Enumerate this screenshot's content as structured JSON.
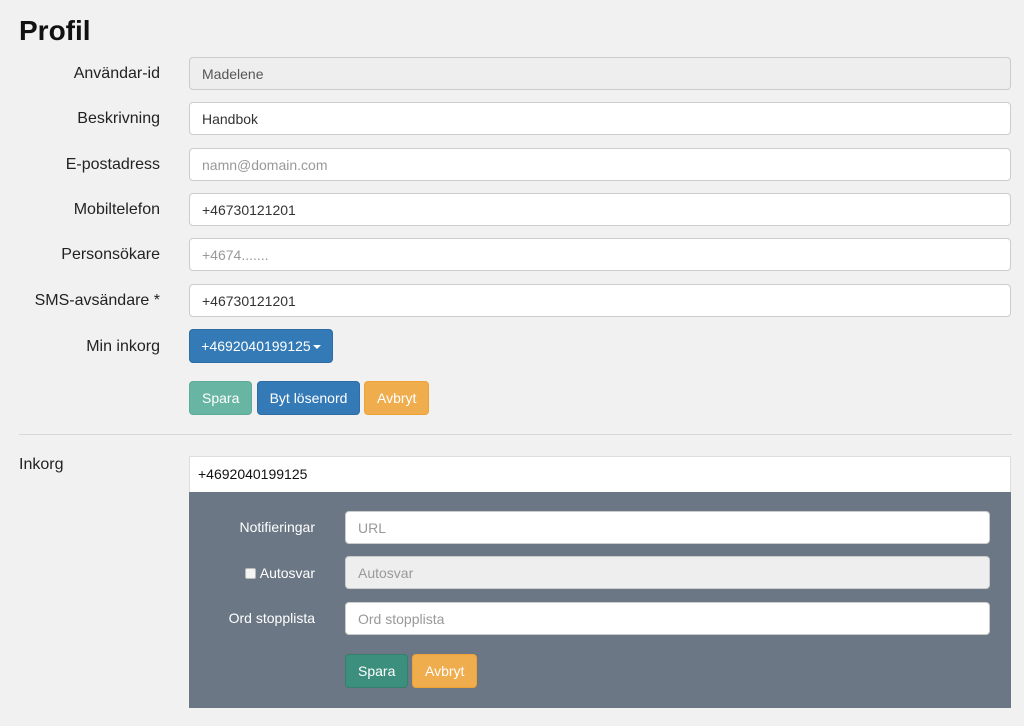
{
  "page": {
    "title": "Profil"
  },
  "profile_form": {
    "user_id": {
      "label": "Användar-id",
      "value": "Madelene"
    },
    "description": {
      "label": "Beskrivning",
      "value": "Handbok"
    },
    "email": {
      "label": "E-postadress",
      "value": "",
      "placeholder": "namn@domain.com"
    },
    "mobile": {
      "label": "Mobiltelefon",
      "value": "+46730121201"
    },
    "pager": {
      "label": "Personsökare",
      "value": "",
      "placeholder": "+4674......."
    },
    "sms_sender": {
      "label": "SMS-avsändare *",
      "value": "+46730121201"
    },
    "my_inbox": {
      "label": "Min inkorg",
      "selected": "+4692040199125"
    },
    "buttons": {
      "save": "Spara",
      "change_password": "Byt lösenord",
      "cancel": "Avbryt"
    }
  },
  "inbox_section": {
    "label": "Inkorg",
    "inbox_number": "+4692040199125",
    "notifications": {
      "label": "Notifieringar",
      "value": "",
      "placeholder": "URL"
    },
    "autoreply": {
      "label": "Autosvar",
      "checked": false,
      "value": "",
      "placeholder": "Autosvar"
    },
    "stopword_list": {
      "label": "Ord stopplista",
      "value": "",
      "placeholder": "Ord stopplista"
    },
    "buttons": {
      "save": "Spara",
      "cancel": "Avbryt"
    }
  },
  "colors": {
    "background": "#f1f1f1",
    "primary": "#337ab7",
    "teal": "#68b5a3",
    "teal_dark": "#3b8f7c",
    "warning": "#f0ad4e",
    "panel": "#6b7785"
  }
}
